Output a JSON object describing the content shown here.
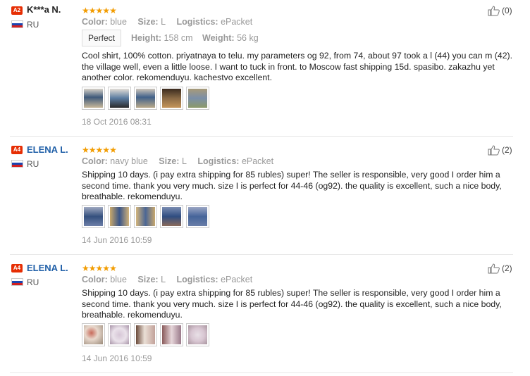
{
  "labels": {
    "color": "Color:",
    "size": "Size:",
    "logistics": "Logistics:",
    "height": "Height:",
    "weight": "Weight:"
  },
  "reviews": [
    {
      "badge": "A2",
      "name": "K***a N.",
      "country": "RU",
      "stars": 5,
      "color": "blue",
      "size": "L",
      "logistics": "ePacket",
      "fit": "Perfect",
      "height": "158 cm",
      "weight": "56 kg",
      "text": "Cool shirt, 100% cotton. priyatnaya to telu. my parameters og 92, from 74, about 97 took a l (44) you can m (42). the village well, even a little loose. I want to tuck in front. to Moscow fast shipping 15d. spasibo. zakazhu yet another color. rekomenduyu. kachestvo excellent.",
      "photo_icons": [
        "photo-icon",
        "photo-icon",
        "photo-icon",
        "photo-icon",
        "photo-icon"
      ],
      "date": "18 Oct 2016 08:31",
      "helpful": "(0)"
    },
    {
      "badge": "A4",
      "name": "ELENA L.",
      "country": "RU",
      "stars": 5,
      "color": "navy blue",
      "size": "L",
      "logistics": "ePacket",
      "text": "Shipping 10 days. (i pay extra shipping for 85 rubles) super! The seller is responsible, very good I order him a second time. thank you very much. size I is perfect for 44-46 (og92). the quality is excellent, such a nice body, breathable. rekomenduyu.",
      "photo_icons": [
        "photo-icon",
        "photo-icon",
        "photo-icon",
        "photo-icon",
        "photo-icon"
      ],
      "date": "14 Jun 2016 10:59",
      "helpful": "(2)"
    },
    {
      "badge": "A4",
      "name": "ELENA L.",
      "country": "RU",
      "stars": 5,
      "color": "blue",
      "size": "L",
      "logistics": "ePacket",
      "text": "Shipping 10 days. (i pay extra shipping for 85 rubles) super! The seller is responsible, very good I order him a second time. thank you very much. size I is perfect for 44-46 (og92). the quality is excellent, such a nice body, breathable. rekomenduyu.",
      "photo_icons": [
        "photo-icon",
        "photo-icon",
        "photo-icon",
        "photo-icon",
        "photo-icon"
      ],
      "date": "14 Jun 2016 10:59",
      "helpful": "(2)"
    }
  ],
  "colors": {
    "badge": "#e62e04",
    "star": "#f29c00",
    "name_blue": "#2160a8",
    "muted": "#999999"
  }
}
